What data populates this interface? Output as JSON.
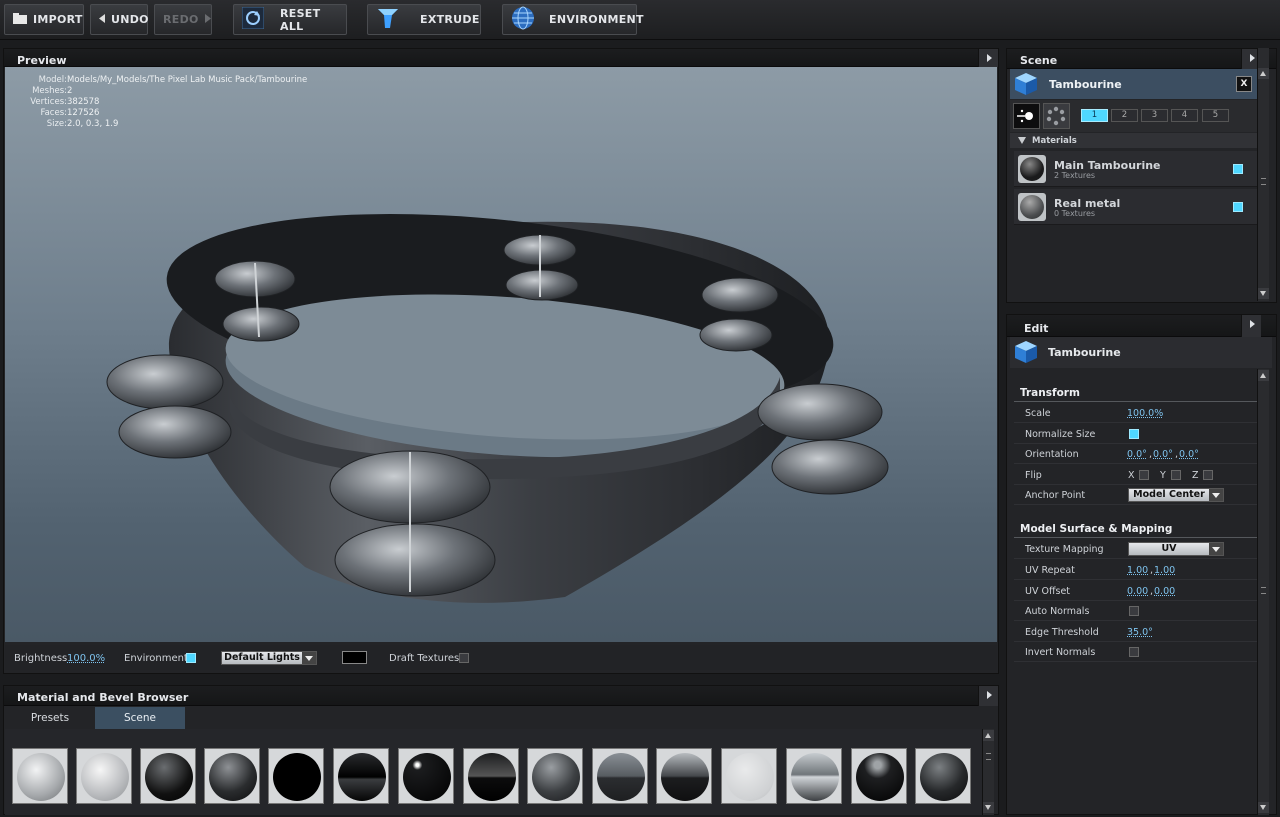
{
  "toolbar": {
    "import_label": "IMPORT",
    "undo_label": "UNDO",
    "redo_label": "REDO",
    "reset_all_label": "RESET ALL",
    "extrude_label": "EXTRUDE",
    "environment_label": "ENVIRONMENT"
  },
  "preview": {
    "title": "Preview",
    "info_labels": [
      "Model:",
      "Meshes:",
      "Vertices:",
      "Faces:",
      "Size:"
    ],
    "info_values": [
      "Models/My_Models/The Pixel Lab Music Pack/Tambourine",
      "2",
      "382578",
      "127526",
      "2.0, 0.3, 1.9"
    ],
    "brightness_label": "Brightness",
    "brightness_value": "100.0%",
    "environment_label": "Environment",
    "environment_checked": true,
    "lights_value": "Default Lights",
    "draft_textures_label": "Draft Textures",
    "draft_textures_checked": false
  },
  "browser": {
    "title": "Material and Bevel Browser",
    "tabs": [
      "Presets",
      "Scene"
    ],
    "active_tab": "Scene"
  },
  "scene": {
    "title": "Scene",
    "object_name": "Tambourine",
    "close_label": "X",
    "layers": [
      "1",
      "2",
      "3",
      "4",
      "5"
    ],
    "active_layer": "1",
    "materials_header": "Materials",
    "materials": [
      {
        "name": "Main Tambourine",
        "sub": "2 Textures"
      },
      {
        "name": "Real metal",
        "sub": "0 Textures"
      }
    ]
  },
  "edit": {
    "title": "Edit",
    "object_name": "Tambourine",
    "transform_header": "Transform",
    "scale_label": "Scale",
    "scale_value": "100.0%",
    "normalize_label": "Normalize Size",
    "orientation_label": "Orientation",
    "orientation_values": [
      "0.0°",
      "0.0°",
      "0.0°"
    ],
    "flip_label": "Flip",
    "flip_axes": [
      "X",
      "Y",
      "Z"
    ],
    "anchor_label": "Anchor Point",
    "anchor_value": "Model Center",
    "surface_header": "Model Surface & Mapping",
    "texture_mapping_label": "Texture Mapping",
    "texture_mapping_value": "UV",
    "uv_repeat_label": "UV Repeat",
    "uv_repeat_values": [
      "1.00",
      "1.00"
    ],
    "uv_offset_label": "UV Offset",
    "uv_offset_values": [
      "0.00",
      "0.00"
    ],
    "auto_normals_label": "Auto Normals",
    "edge_threshold_label": "Edge Threshold",
    "edge_threshold_value": "35.0°",
    "invert_normals_label": "Invert Normals"
  },
  "colors": {
    "accent": "#4fd7ff",
    "value_text": "#7ec3ee",
    "selection": "#3c4e61"
  }
}
